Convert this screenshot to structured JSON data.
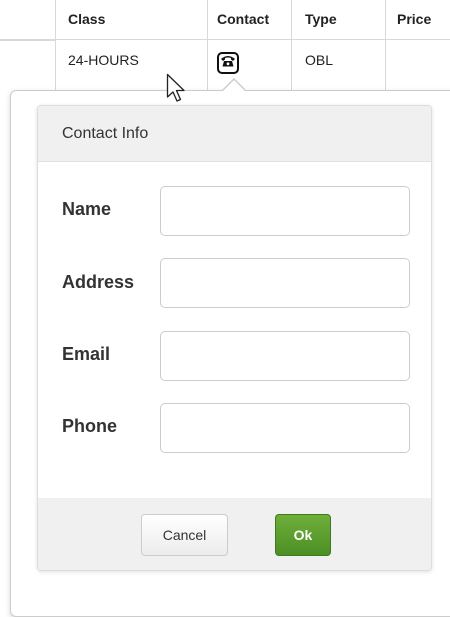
{
  "grid": {
    "columns": [
      "Class",
      "Contact",
      "Type",
      "Price"
    ],
    "row": {
      "class": "24-HOURS",
      "contact_icon": "phone-icon",
      "type": "OBL",
      "price": ""
    }
  },
  "dialog": {
    "title": "Contact Info",
    "fields": [
      {
        "label": "Name",
        "value": "",
        "placeholder": ""
      },
      {
        "label": "Address",
        "value": "",
        "placeholder": ""
      },
      {
        "label": "Email",
        "value": "",
        "placeholder": ""
      },
      {
        "label": "Phone",
        "value": "",
        "placeholder": ""
      }
    ],
    "cancel_label": "Cancel",
    "ok_label": "Ok"
  },
  "colors": {
    "ok_button": "#5a9e2f",
    "header_bg": "#f0f0f0",
    "border": "#cccccc"
  }
}
